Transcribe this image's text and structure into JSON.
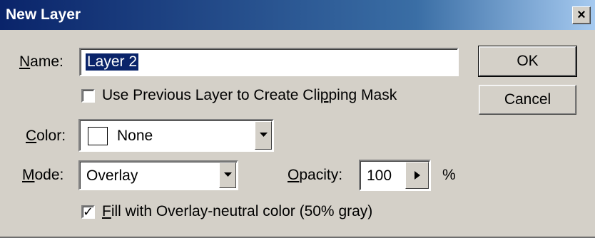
{
  "dialog": {
    "title": "New Layer",
    "close_glyph": "×"
  },
  "name": {
    "label_mnemonic": "N",
    "label_rest": "ame:",
    "value": "Layer 2"
  },
  "clip_checkbox": {
    "checked": false,
    "label_before": "Use Previous Layer to Create Cli",
    "label_mnemonic": "p",
    "label_after": "ping Mask"
  },
  "color": {
    "label_mnemonic": "C",
    "label_rest": "olor:",
    "selected": "None",
    "swatch_color": "#ffffff"
  },
  "mode": {
    "label_mnemonic": "M",
    "label_rest": "ode:",
    "selected": "Overlay"
  },
  "opacity": {
    "label_mnemonic": "O",
    "label_rest": "pacity:",
    "value": "100",
    "unit": "%"
  },
  "fill_checkbox": {
    "checked": true,
    "check_glyph": "✓",
    "label_mnemonic": "F",
    "label_rest": "ill with Overlay-neutral color (50% gray)"
  },
  "buttons": {
    "ok": "OK",
    "cancel": "Cancel"
  },
  "icons": {
    "combo_arrow": "chevron-down-icon",
    "spin_arrow": "play-right-icon"
  }
}
